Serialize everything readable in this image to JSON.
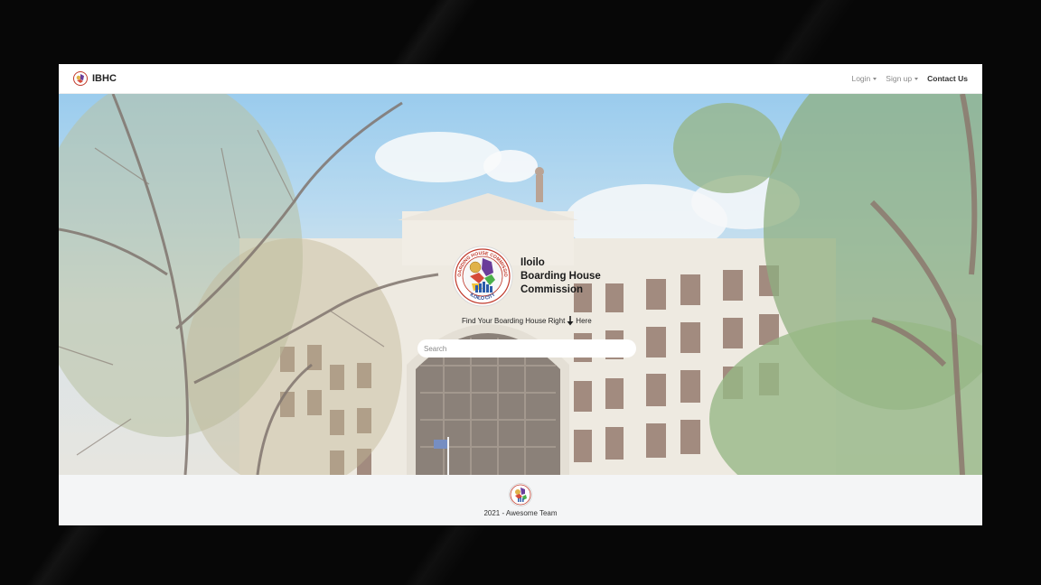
{
  "navbar": {
    "brand": "IBHC",
    "links": [
      {
        "label": "Login",
        "dropdown": true
      },
      {
        "label": "Sign up",
        "dropdown": true
      },
      {
        "label": "Contact Us",
        "dropdown": false
      }
    ]
  },
  "hero": {
    "title_line1": "Iloilo",
    "title_line2": "Boarding House",
    "title_line3": "Commission",
    "tagline_before": "Find Your Boarding House Right",
    "tagline_after": "Here",
    "search_placeholder": "Search",
    "search_value": ""
  },
  "footer": {
    "text": "2021 - Awesome Team"
  },
  "logo": {
    "ring_text_top": "BOARDING HOUSE COMMISSION",
    "ring_text_bottom": "ILOILO CITY"
  },
  "colors": {
    "page_bg": "#070707",
    "navbar_bg": "#ffffff",
    "footer_bg": "#f4f5f6",
    "logo_red": "#c0392b",
    "logo_purple": "#6a3d9a"
  },
  "icons": {
    "arrow": "arrow-down-icon",
    "brand_logo": "ibhc-logo-icon"
  }
}
